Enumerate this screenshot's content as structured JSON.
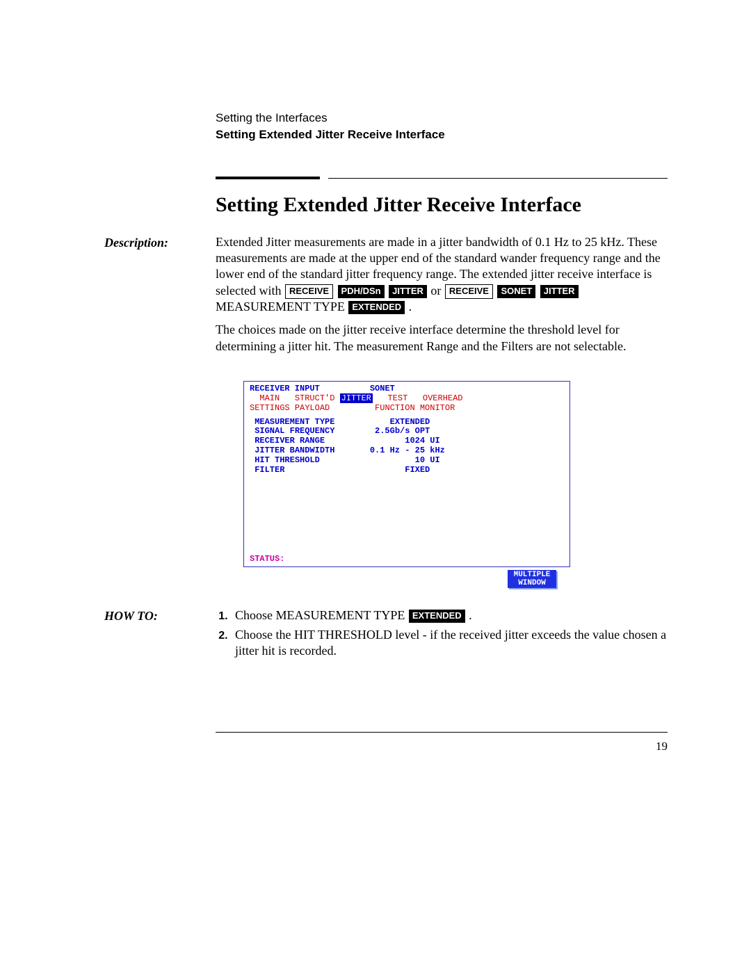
{
  "header": {
    "chapter": "Setting the Interfaces",
    "section": "Setting Extended Jitter Receive Interface"
  },
  "title": "Setting Extended Jitter Receive Interface",
  "sidelabels": {
    "description": "Description:",
    "howto": "HOW TO:"
  },
  "desc": {
    "p1_a": "Extended Jitter measurements are made in a jitter bandwidth of 0.1 Hz to 25 kHz. These measurements are made at the upper end of the standard wander frequency range and the lower end of the standard jitter frequency range. The extended jitter receive interface is selected with ",
    "p1_or": " or ",
    "p1_end": "MEASUREMENT TYPE ",
    "p1_period": ".",
    "p2": "The choices made on the jitter receive interface determine the threshold level for determining a jitter hit. The measurement Range and the Filters are not selectable."
  },
  "keys": {
    "receive": "RECEIVE",
    "pdhdsn": "PDH/DSn",
    "jitter": "JITTER",
    "sonet": "SONET",
    "extended": "EXTENDED"
  },
  "screen": {
    "title_left": "RECEIVER INPUT",
    "title_right": "SONET",
    "tabs": {
      "main": "MAIN",
      "structd": "STRUCT'D",
      "jitter": "JITTER",
      "test": "TEST",
      "overhead": "OVERHEAD"
    },
    "tabs2": {
      "settings": "SETTINGS",
      "payload": "PAYLOAD",
      "function": "FUNCTION",
      "monitor": "MONITOR"
    },
    "rows": {
      "meas_type_l": "MEASUREMENT TYPE",
      "meas_type_v": "EXTENDED",
      "sig_freq_l": "SIGNAL FREQUENCY",
      "sig_freq_v": "2.5Gb/s OPT",
      "rx_range_l": "RECEIVER RANGE",
      "rx_range_v": "1024 UI",
      "jit_bw_l": "JITTER BANDWIDTH",
      "jit_bw_v": "0.1 Hz - 25 kHz",
      "hit_thr_l": "HIT THRESHOLD",
      "hit_thr_v": "10 UI",
      "filter_l": "FILTER",
      "filter_v": "FIXED"
    },
    "status": "STATUS:",
    "multwin1": "MULTIPLE",
    "multwin2": "WINDOW"
  },
  "howto": {
    "step1_a": "Choose MEASUREMENT TYPE ",
    "step1_b": ".",
    "step2": "Choose the HIT THRESHOLD level - if the received jitter exceeds the value chosen a jitter hit is recorded."
  },
  "page_number": "19"
}
